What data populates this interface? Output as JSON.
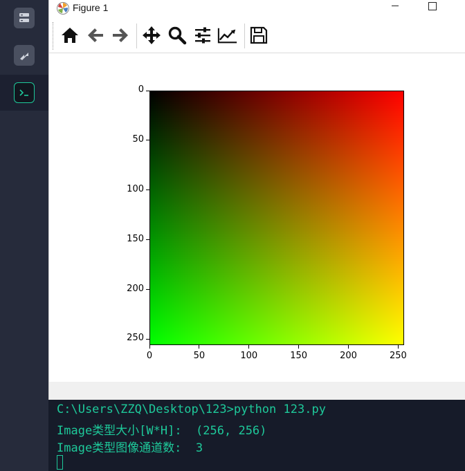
{
  "window": {
    "title": "Figure 1"
  },
  "toolbar": {
    "buttons": [
      "home-icon",
      "back-arrow-icon",
      "forward-arrow-icon",
      "pan-icon",
      "zoom-icon",
      "subplots-config-icon",
      "edit-axis-icon",
      "save-icon"
    ]
  },
  "sidebar": {
    "items": [
      "database-icon",
      "share-icon",
      "terminal-icon"
    ]
  },
  "chart_data": {
    "type": "image",
    "image_size": [
      256,
      256
    ],
    "color_encoding": {
      "x": "red channel 0 to 255",
      "y": "green channel 0 to 255",
      "blue": 0
    },
    "x_ticks": [
      "0",
      "50",
      "100",
      "150",
      "200",
      "250"
    ],
    "y_ticks": [
      "0",
      "50",
      "100",
      "150",
      "200",
      "250"
    ],
    "xlim": [
      0,
      256
    ],
    "ylim": [
      256,
      0
    ]
  },
  "terminal": {
    "lines": [
      "C:\\Users\\ZZQ\\Desktop\\123>python 123.py",
      "Image类型大小[W*H]:  (256, 256)",
      "Image类型图像通道数:  3"
    ]
  }
}
